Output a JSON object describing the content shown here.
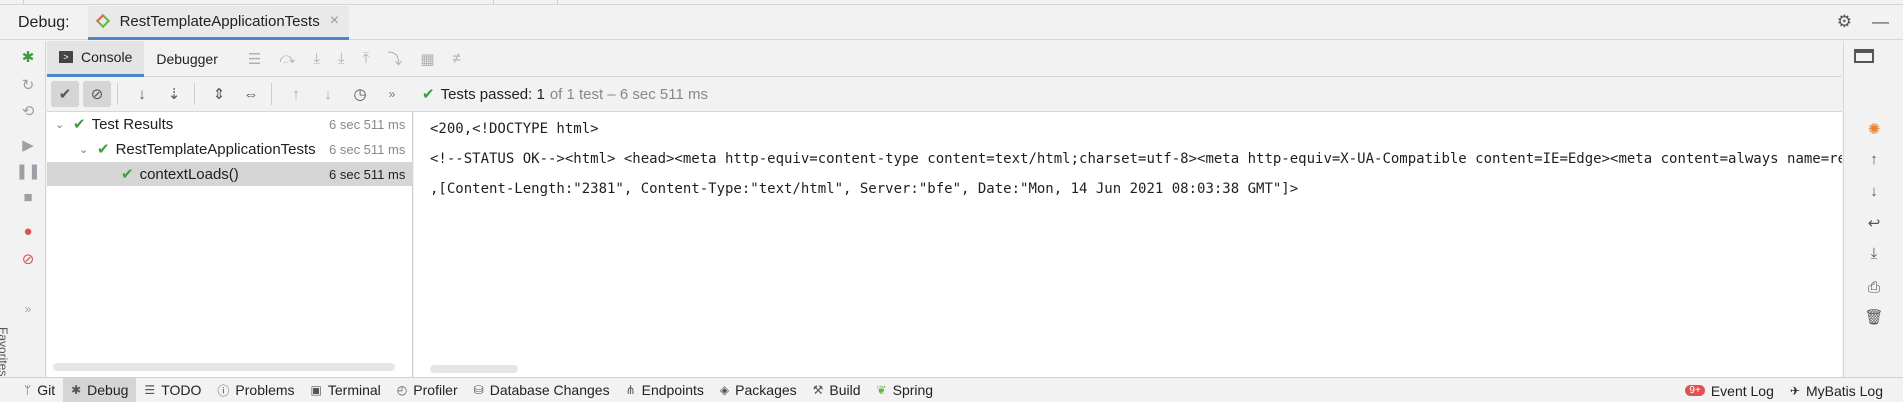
{
  "header": {
    "debug_label": "Debug:",
    "tab_title": "RestTemplateApplicationTests",
    "close_glyph": "×",
    "settings_glyph": "⚙",
    "minimize_glyph": "—"
  },
  "subtabs": {
    "console": "Console",
    "debugger": "Debugger"
  },
  "status": {
    "passed_label": "Tests passed:",
    "count": "1",
    "detail": "of 1 test – 6 sec 511 ms"
  },
  "tree": {
    "rows": [
      {
        "name": "Test Results",
        "time": "6 sec 511 ms"
      },
      {
        "name": "RestTemplateApplicationTests",
        "time": "6 sec 511 ms"
      },
      {
        "name": "contextLoads()",
        "time": "6 sec 511 ms"
      }
    ]
  },
  "console": {
    "lines": [
      "<200,<!DOCTYPE html>",
      "<!--STATUS OK--><html> <head><meta http-equiv=content-type content=text/html;charset=utf-8><meta http-equiv=X-UA-Compatible content=IE=Edge><meta content=always name=referrer>",
      ",[Content-Length:\"2381\", Content-Type:\"text/html\", Server:\"bfe\", Date:\"Mon, 14 Jun 2021 08:03:38 GMT\"]>"
    ]
  },
  "left_vertical_label": "Favorites",
  "bottom": {
    "items": [
      "Git",
      "Debug",
      "TODO",
      "Problems",
      "Terminal",
      "Profiler",
      "Database Changes",
      "Endpoints",
      "Packages",
      "Build",
      "Spring"
    ],
    "badge": "9+",
    "event_log": "Event Log",
    "mybatis_log": "MyBatis Log"
  }
}
